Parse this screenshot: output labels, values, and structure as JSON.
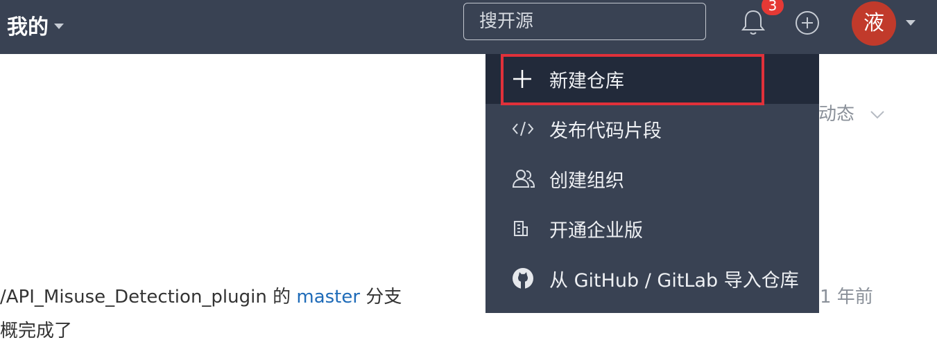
{
  "header": {
    "title": "我的",
    "search_placeholder": "搜开源",
    "notification_count": "3",
    "avatar_letter": "液"
  },
  "dropdown": {
    "items": [
      {
        "label": "新建仓库",
        "icon": "plus-icon"
      },
      {
        "label": "发布代码片段",
        "icon": "code-icon"
      },
      {
        "label": "创建组织",
        "icon": "users-icon"
      },
      {
        "label": "开通企业版",
        "icon": "building-icon"
      },
      {
        "label": "从 GitHub / GitLab 导入仓库",
        "icon": "github-icon"
      }
    ]
  },
  "background": {
    "activity_label": "动态",
    "feed_repo": "/API_Misuse_Detection_plugin 的 ",
    "feed_branch": "master",
    "feed_suffix": " 分支",
    "feed_time": "1 年前",
    "feed_message": "概完成了"
  },
  "colors": {
    "navbar": "#394253",
    "menu_active": "#222a3a",
    "highlight": "#e0313a",
    "avatar": "#c13a2b",
    "link": "#1e6bb8"
  }
}
